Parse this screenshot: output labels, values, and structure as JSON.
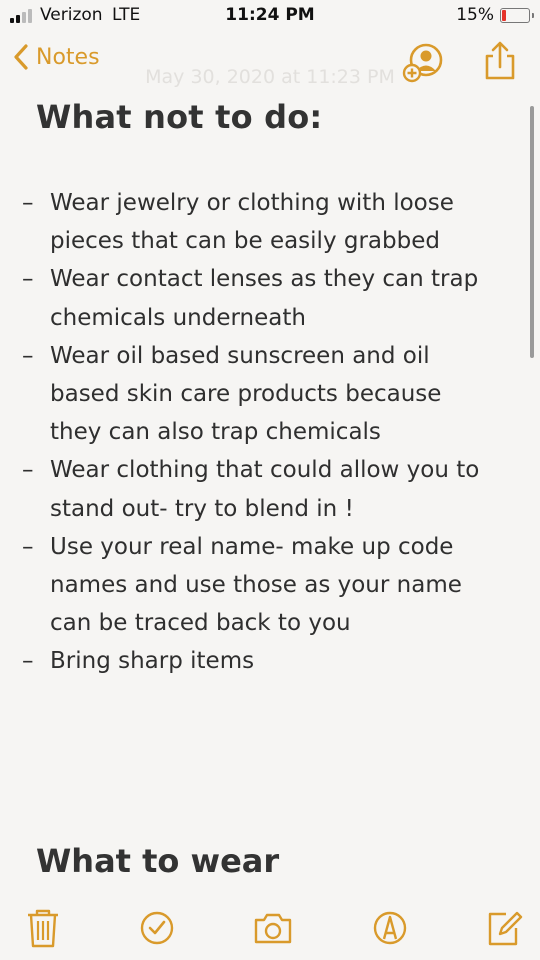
{
  "status_bar": {
    "carrier": "Verizon",
    "network": "LTE",
    "time": "11:24 PM",
    "battery_percent": "15%"
  },
  "nav": {
    "back_label": "Notes",
    "date": "May 30, 2020 at 11:23 PM",
    "accent_color": "#d99a2b"
  },
  "note": {
    "heading": "What not to do:",
    "items": [
      "Wear jewelry or clothing with loose pieces that can be easily grabbed",
      "Wear contact lenses as they can trap chemicals underneath",
      "Wear oil based sunscreen and oil based skin care products because they can also trap chemicals",
      "Wear clothing that could allow you to stand out- try to blend in !",
      "Use your real name- make up code names and use those as your name can be traced back to you",
      "Bring sharp items"
    ],
    "next_heading": "What to wear"
  },
  "toolbar": {
    "icons": [
      "trash-icon",
      "checklist-icon",
      "camera-icon",
      "markup-icon",
      "compose-icon"
    ]
  }
}
